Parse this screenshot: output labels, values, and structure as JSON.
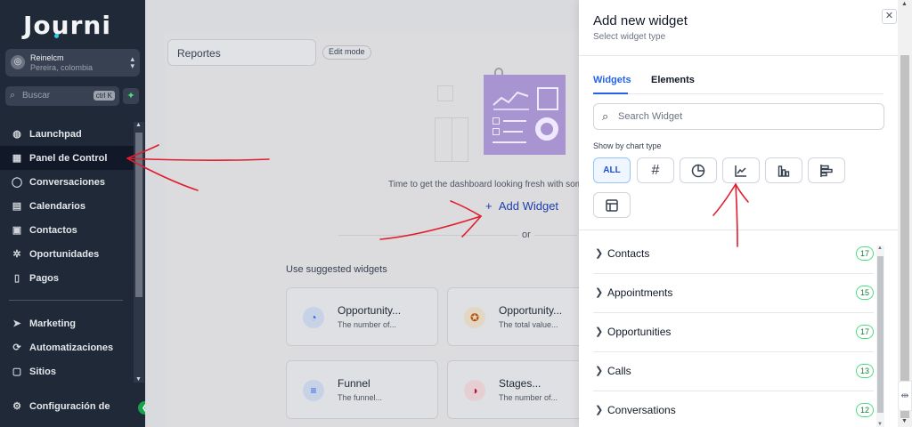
{
  "app": {
    "logo": "Journi"
  },
  "account": {
    "name": "Reinelcm",
    "location": "Pereira, colombia"
  },
  "sidebar_search": {
    "placeholder": "Buscar",
    "shortcut": "ctrl K"
  },
  "nav": [
    {
      "label": "Launchpad",
      "icon": "launchpad-icon"
    },
    {
      "label": "Panel de Control",
      "icon": "dashboard-grid-icon",
      "active": true
    },
    {
      "label": "Conversaciones",
      "icon": "chat-bubble-icon"
    },
    {
      "label": "Calendarios",
      "icon": "calendar-icon"
    },
    {
      "label": "Contactos",
      "icon": "contacts-icon"
    },
    {
      "label": "Oportunidades",
      "icon": "network-icon"
    },
    {
      "label": "Pagos",
      "icon": "receipt-icon"
    },
    {
      "label": "Marketing",
      "icon": "send-icon"
    },
    {
      "label": "Automatizaciones",
      "icon": "automation-icon"
    },
    {
      "label": "Sitios",
      "icon": "globe-window-icon"
    },
    {
      "label": "Configuración de",
      "icon": "gear-icon"
    }
  ],
  "dashboard": {
    "name": "Reportes",
    "edit_mode": "Edit mode",
    "helper_text": "Time to get the dashboard looking fresh with som",
    "add_widget": "Add Widget",
    "or": "or",
    "suggested_heading": "Use suggested widgets",
    "cards": [
      {
        "title": "Opportunity...",
        "desc": "The number of..."
      },
      {
        "title": "Opportunity...",
        "desc": "The total value..."
      },
      {
        "title": "Funnel",
        "desc": "The funnel..."
      },
      {
        "title": "Stages...",
        "desc": "The number of..."
      }
    ]
  },
  "drawer": {
    "title": "Add new widget",
    "subtitle": "Select widget type",
    "tabs": [
      {
        "label": "Widgets",
        "active": true
      },
      {
        "label": "Elements"
      }
    ],
    "search_placeholder": "Search Widget",
    "chart_type_label": "Show by chart type",
    "filters": [
      {
        "label": "ALL",
        "active": true
      },
      {
        "label": "#",
        "icon": "number-icon"
      },
      {
        "icon": "pie-chart-icon"
      },
      {
        "icon": "line-chart-icon"
      },
      {
        "icon": "bar-chart-icon"
      },
      {
        "icon": "horizontal-bar-chart-icon"
      },
      {
        "icon": "table-icon"
      }
    ],
    "categories": [
      {
        "label": "Contacts",
        "count": "17"
      },
      {
        "label": "Appointments",
        "count": "15"
      },
      {
        "label": "Opportunities",
        "count": "17"
      },
      {
        "label": "Calls",
        "count": "13"
      },
      {
        "label": "Conversations",
        "count": "12"
      }
    ]
  },
  "colors": {
    "sidebar": "#1f2937",
    "accent": "#2563eb",
    "badge": "#4ade80",
    "annotation": "#e11d2e"
  }
}
